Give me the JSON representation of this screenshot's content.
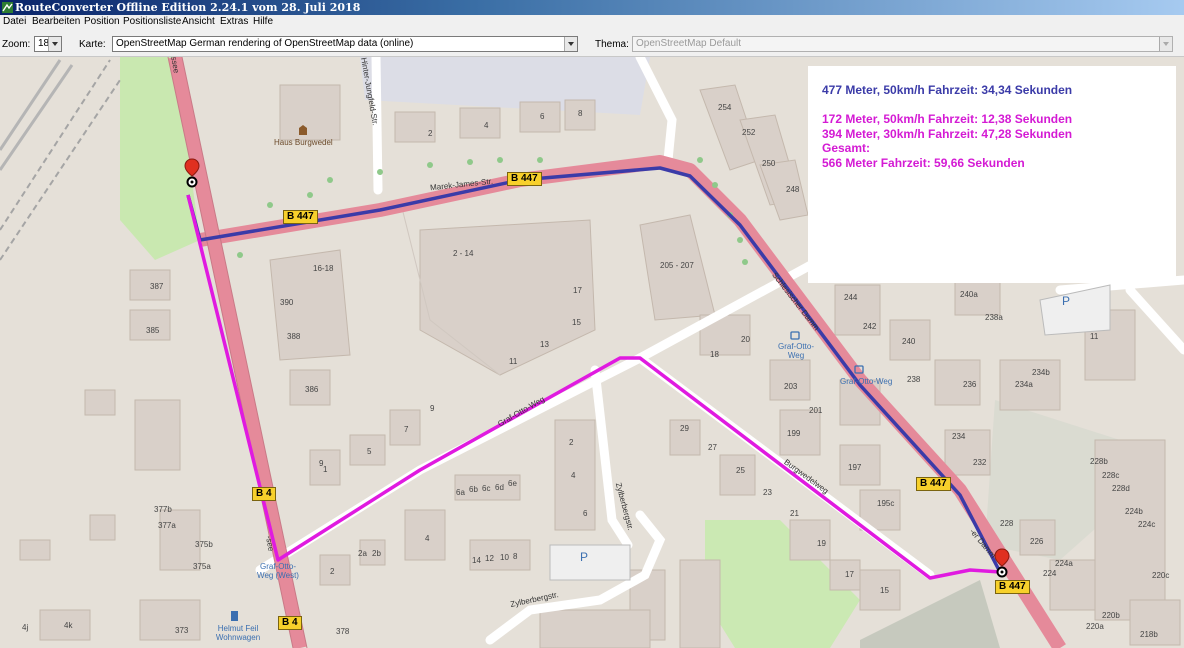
{
  "window": {
    "title": "RouteConverter Offline Edition 2.24.1 vom 28. Juli 2018"
  },
  "menu": {
    "items": [
      "Datei",
      "Bearbeiten",
      "Position",
      "Positionsliste",
      "Ansicht",
      "Extras",
      "Hilfe"
    ]
  },
  "toolbar": {
    "zoom_label": "Zoom:",
    "zoom_value": "18",
    "map_label": "Karte:",
    "map_value": "OpenStreetMap German rendering of OpenStreetMap data (online)",
    "theme_label": "Thema:",
    "theme_value": "OpenStreetMap Default"
  },
  "info": {
    "line1": "477 Meter, 50km/h Fahrzeit: 34,34 Sekunden",
    "line2": "172 Meter, 50km/h Fahrzeit: 12,38 Sekunden",
    "line3": "394 Meter, 30km/h Fahrzeit: 47,28 Sekunden",
    "line4": "Gesamt:",
    "line5": "566 Meter Fahrzeit: 59,66 Sekunden",
    "colors": {
      "blue": "#3b3ba8",
      "magenta": "#d41ad4"
    }
  },
  "map": {
    "road_badges": [
      "B 447",
      "B 447",
      "B 4",
      "B 447",
      "B 447",
      "B 4"
    ],
    "streets": [
      "Marek-James-Str.",
      "Schlesischer Damm",
      "Graf-Otto-Weg",
      "Burgwedelweg",
      "Zylberbergstr.",
      "Zylberbergstr.",
      "Hinter-Jungfeld-Str.",
      "-ssee",
      "-see",
      "-er Damm"
    ],
    "pois": [
      "Haus Burgwedel",
      "Graf-Otto-Weg",
      "Graf-Otto-Weg",
      "Graf-Otto-Weg (West)",
      "Helmut Feil Wohnwagen"
    ],
    "house_numbers": [
      "2",
      "4",
      "6",
      "8",
      "254",
      "252",
      "250",
      "248",
      "16-18",
      "2 - 14",
      "205 - 207",
      "387",
      "385",
      "390",
      "388",
      "386",
      "17",
      "15",
      "13",
      "11",
      "18",
      "20",
      "244",
      "242",
      "240",
      "238",
      "236",
      "240a",
      "238a",
      "234b",
      "234a",
      "11",
      "9",
      "203",
      "201",
      "199",
      "197",
      "195c",
      "234",
      "232",
      "228",
      "226",
      "224",
      "224a",
      "228b",
      "228c",
      "228d",
      "224b",
      "224c",
      "9",
      "7",
      "5",
      "1",
      "29",
      "27",
      "25",
      "23",
      "21",
      "19",
      "17",
      "15",
      "2",
      "4",
      "6",
      "6a",
      "6b",
      "6c",
      "6d",
      "6e",
      "4",
      "2a",
      "2b",
      "2",
      "14",
      "12",
      "10",
      "8",
      "377b",
      "377a",
      "375b",
      "375a",
      "373",
      "378",
      "4j",
      "4k",
      "220b",
      "220a",
      "218b",
      "220c"
    ],
    "parking_symbol": "P",
    "route_colors": {
      "main": "#3b3ba8",
      "alt": "#e01ae0"
    }
  }
}
